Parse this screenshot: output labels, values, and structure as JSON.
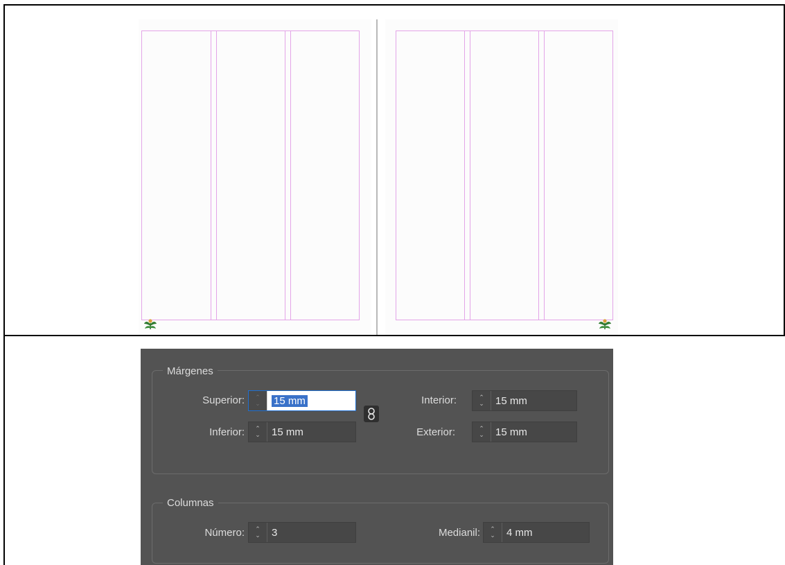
{
  "spread": {
    "pages": [
      {
        "name": "left-page",
        "columns": 3,
        "icon": "plant-icon"
      },
      {
        "name": "right-page",
        "columns": 3,
        "icon": "plant-icon"
      }
    ]
  },
  "dialog": {
    "margins": {
      "title": "Márgenes",
      "top_label": "Superior:",
      "top_value": "15 mm",
      "bottom_label": "Inferior:",
      "bottom_value": "15 mm",
      "inside_label": "Interior:",
      "inside_value": "15 mm",
      "outside_label": "Exterior:",
      "outside_value": "15 mm",
      "link_icon": "chain-link-icon"
    },
    "columns": {
      "title": "Columnas",
      "number_label": "Número:",
      "number_value": "3",
      "gutter_label": "Medianil:",
      "gutter_value": "4 mm"
    }
  },
  "colors": {
    "guide": "#e3a4e8",
    "dialog_bg": "#535353",
    "selection": "#3a72c9"
  }
}
